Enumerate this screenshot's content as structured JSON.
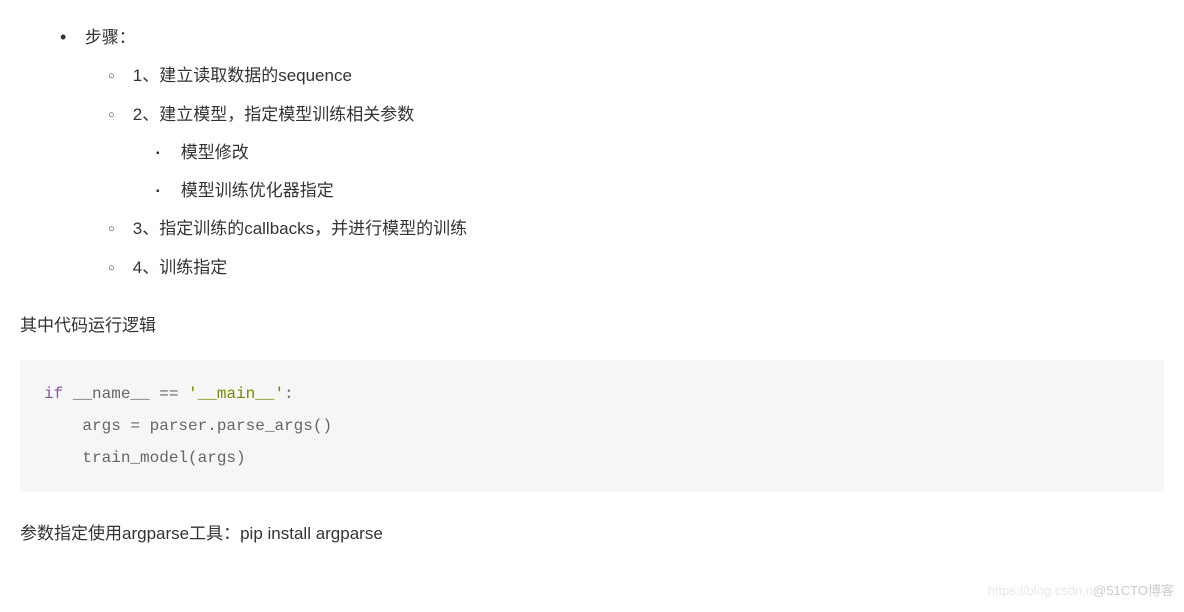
{
  "list": {
    "title": "步骤：",
    "items": [
      {
        "label": "1、建立读取数据的sequence"
      },
      {
        "label": "2、建立模型，指定模型训练相关参数",
        "children": [
          "模型修改",
          "模型训练优化器指定"
        ]
      },
      {
        "label": "3、指定训练的callbacks，并进行模型的训练"
      },
      {
        "label": "4、训练指定"
      }
    ]
  },
  "paragraph1": "其中代码运行逻辑",
  "code": {
    "line1_kw": "if",
    "line1_ident": " __name__ ",
    "line1_eq": "== ",
    "line1_str": "'__main__'",
    "line1_colon": ":",
    "line2": "    args = parser.parse_args()",
    "line3": "    train_model(args)"
  },
  "paragraph2": "参数指定使用argparse工具：pip install argparse",
  "watermark": {
    "faint": "https://blog.csdn.n",
    "text": "@51CTO博客"
  }
}
